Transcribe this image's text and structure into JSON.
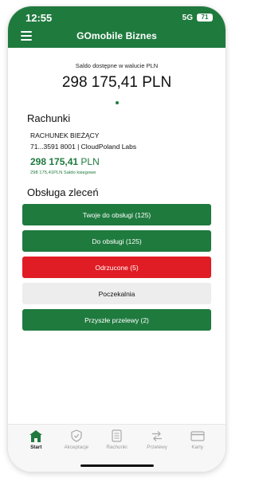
{
  "status_bar": {
    "time": "12:55",
    "network": "5G",
    "battery": "71"
  },
  "header": {
    "title": "GOmobile Biznes",
    "menu_icon": "hamburger-menu-icon"
  },
  "balance": {
    "label": "Saldo dostępne w walucie PLN",
    "amount": "298 175,41 PLN"
  },
  "accounts": {
    "title": "Rachunki",
    "items": [
      {
        "type": "RACHUNEK BIEŻĄCY",
        "number_line": "71...3591 8001 | CloudPoland Labs",
        "balance": "298 175,41",
        "currency": "PLN",
        "book_balance": "298 175,41PLN Saldo księgowe"
      }
    ]
  },
  "orders": {
    "title": "Obsługa zleceń",
    "buttons": [
      {
        "label": "Twoje do obsługi (125)",
        "color": "#1f7a3e"
      },
      {
        "label": "Do obsługi (125)",
        "color": "#1f7a3e"
      },
      {
        "label": "Odrzucone (5)",
        "color": "#e01c24"
      },
      {
        "label": "Poczekalnia",
        "color": "#ededed"
      },
      {
        "label": "Przyszłe przelewy (2)",
        "color": "#1f7a3e"
      }
    ]
  },
  "tabbar": {
    "tabs": [
      {
        "label": "Start",
        "icon": "home-icon",
        "active": true
      },
      {
        "label": "Akceptacje",
        "icon": "shield-check-icon",
        "active": false
      },
      {
        "label": "Rachunki",
        "icon": "document-icon",
        "active": false
      },
      {
        "label": "Przelewy",
        "icon": "transfer-arrows-icon",
        "active": false
      },
      {
        "label": "Karty",
        "icon": "card-icon",
        "active": false
      }
    ]
  },
  "colors": {
    "brand": "#1f7a3e",
    "danger": "#e01c24"
  }
}
